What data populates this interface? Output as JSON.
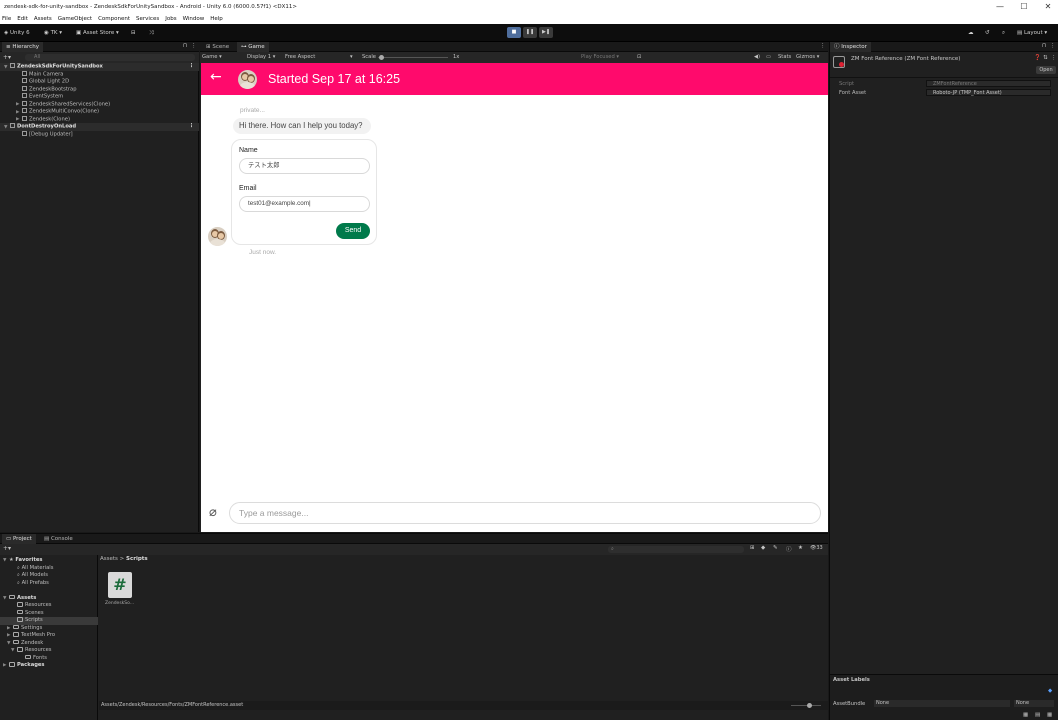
{
  "window": {
    "title": "zendesk-sdk-for-unity-sandbox - ZendeskSdkForUnitySandbox - Android - Unity 6.0 (6000.0.57f1) <DX11>",
    "controls": [
      "—",
      "☐",
      "✕"
    ]
  },
  "menu": [
    "File",
    "Edit",
    "Assets",
    "GameObject",
    "Component",
    "Services",
    "Jobs",
    "Window",
    "Help"
  ],
  "toolbar": {
    "unity_label": "Unity 6",
    "account_label": "TK",
    "asset_store_label": "Asset Store",
    "layout_label": "Layout"
  },
  "hierarchy": {
    "tab_label": "Hierarchy",
    "search_placeholder": "All",
    "rows": [
      {
        "label": "ZendeskSdkForUnitySandbox",
        "indent": 0,
        "expand": "▼",
        "kind": "scene"
      },
      {
        "label": "Main Camera",
        "indent": 2,
        "expand": "",
        "kind": "object"
      },
      {
        "label": "Global Light 2D",
        "indent": 2,
        "expand": "",
        "kind": "object"
      },
      {
        "label": "ZendeskBootstrap",
        "indent": 2,
        "expand": "",
        "kind": "object"
      },
      {
        "label": "EventSystem",
        "indent": 2,
        "expand": "",
        "kind": "object"
      },
      {
        "label": "ZendeskSharedServices(Clone)",
        "indent": 2,
        "expand": "▶",
        "kind": "object"
      },
      {
        "label": "ZendeskMultiConvo(Clone)",
        "indent": 2,
        "expand": "▶",
        "kind": "object"
      },
      {
        "label": "Zendesk(Clone)",
        "indent": 2,
        "expand": "▶",
        "kind": "object"
      },
      {
        "label": "DontDestroyOnLoad",
        "indent": 0,
        "expand": "▼",
        "kind": "scene"
      },
      {
        "label": "[Debug Updater]",
        "indent": 2,
        "expand": "",
        "kind": "object"
      }
    ]
  },
  "scene_tabs": {
    "scene": "Scene",
    "game": "Game"
  },
  "game_toolbar": {
    "mode": "Game",
    "display": "Display 1",
    "aspect": "Free Aspect",
    "scale_label": "Scale",
    "scale_value": "1x",
    "play_focused": "Play Focused",
    "stats": "Stats",
    "gizmos": "Gizmos"
  },
  "chat": {
    "header_title": "Started Sep 17 at 16:25",
    "sender_label": "private...",
    "greeting": "Hi there. How can I help you today?",
    "form": {
      "name_label": "Name",
      "name_value": "テスト太郎",
      "email_label": "Email",
      "email_value": "test01@example.com",
      "send_label": "Send"
    },
    "timestamp": "Just now.",
    "message_placeholder": "Type a message..."
  },
  "inspector": {
    "tab_label": "Inspector",
    "object_title": "ZM Font Reference (ZM Font Reference)",
    "open_label": "Open",
    "script_label": "Script",
    "script_value": "ZMFontReference",
    "font_asset_label": "Font Asset",
    "font_asset_value": "Roboto-JP (TMP_Font Asset)",
    "asset_labels": "Asset Labels",
    "asset_bundle_label": "AssetBundle",
    "asset_bundle_value": "None",
    "asset_variant_value": "None"
  },
  "project": {
    "tabs": [
      "Project",
      "Console"
    ],
    "search_count": "33",
    "breadcrumb": [
      "Assets",
      "Scripts"
    ],
    "tree": [
      {
        "label": "Favorites",
        "indent": 0,
        "expand": "▼",
        "head": true
      },
      {
        "label": "All Materials",
        "indent": 2,
        "expand": "",
        "head": false
      },
      {
        "label": "All Models",
        "indent": 2,
        "expand": "",
        "head": false
      },
      {
        "label": "All Prefabs",
        "indent": 2,
        "expand": "",
        "head": false
      },
      {
        "label": "",
        "indent": 0,
        "expand": "",
        "head": false
      },
      {
        "label": "Assets",
        "indent": 0,
        "expand": "▼",
        "head": true
      },
      {
        "label": "Resources",
        "indent": 2,
        "expand": "",
        "head": false
      },
      {
        "label": "Scenes",
        "indent": 2,
        "expand": "",
        "head": false
      },
      {
        "label": "Scripts",
        "indent": 2,
        "expand": "",
        "head": false
      },
      {
        "label": "Settings",
        "indent": 1,
        "expand": "▶",
        "head": false
      },
      {
        "label": "TextMesh Pro",
        "indent": 1,
        "expand": "▶",
        "head": false
      },
      {
        "label": "Zendesk",
        "indent": 1,
        "expand": "▼",
        "head": false
      },
      {
        "label": "Resources",
        "indent": 2,
        "expand": "▼",
        "head": false
      },
      {
        "label": "Fonts",
        "indent": 4,
        "expand": "",
        "head": false
      },
      {
        "label": "Packages",
        "indent": 0,
        "expand": "▶",
        "head": true
      }
    ],
    "asset_item": "ZendeskSo...",
    "status_path": "Assets/Zendesk/Resources/Fonts/ZMFontReference.asset"
  },
  "colors": {
    "chat_header": "#ff0a6c",
    "send_button": "#007a4b",
    "editor_bg": "#191919"
  }
}
